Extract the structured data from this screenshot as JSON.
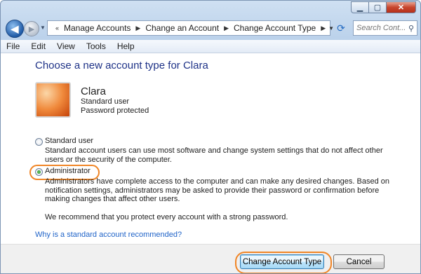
{
  "addressbar": {
    "path": [
      "Manage Accounts",
      "Change an Account",
      "Change Account Type"
    ],
    "search_placeholder": "Search Cont..."
  },
  "menu": [
    "File",
    "Edit",
    "View",
    "Tools",
    "Help"
  ],
  "page": {
    "heading": "Choose a new account type for Clara",
    "user": {
      "name": "Clara",
      "type": "Standard user",
      "status": "Password protected"
    },
    "options": [
      {
        "label": "Standard user",
        "selected": false,
        "description": "Standard account users can use most software and change system settings that do not affect other users or the security of the computer."
      },
      {
        "label": "Administrator",
        "selected": true,
        "description": "Administrators have complete access to the computer and can make any desired changes. Based on notification settings, administrators may be asked to provide their password or confirmation before making changes that affect other users."
      }
    ],
    "recommendation": "We recommend that you protect every account with a strong password.",
    "help_link": "Why is a standard account recommended?"
  },
  "buttons": {
    "change": "Change Account Type",
    "cancel": "Cancel"
  },
  "colors": {
    "heading": "#1e3287",
    "link": "#1f63c8",
    "highlight": "#f08526"
  },
  "icons": {
    "back": "back-arrow-icon",
    "forward": "forward-arrow-icon",
    "refresh": "refresh-icon",
    "search": "search-icon",
    "control_panel": "control-panel-icon"
  }
}
